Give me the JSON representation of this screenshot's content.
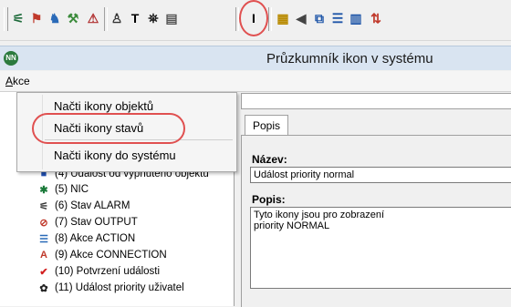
{
  "toolbar": {
    "buttons": [
      {
        "name": "connect-icon",
        "glyph": "⚟",
        "color": "#1d6a3a"
      },
      {
        "name": "flag-icon",
        "glyph": "⚑",
        "color": "#c0392b"
      },
      {
        "name": "users-icon",
        "glyph": "♞",
        "color": "#2a6ab8"
      },
      {
        "name": "tools-icon",
        "glyph": "⚒",
        "color": "#3a8a3a"
      },
      {
        "name": "alarm-icon",
        "glyph": "⚠",
        "color": "#b03030"
      },
      {
        "name": "user-text-icon",
        "glyph": "♙",
        "color": "#333"
      },
      {
        "name": "text-icon",
        "glyph": "T",
        "color": "#000"
      },
      {
        "name": "binoculars-icon",
        "glyph": "⛯",
        "color": "#222"
      },
      {
        "name": "document-icon",
        "glyph": "▤",
        "color": "#555"
      },
      {
        "name": "icon-explorer-icon",
        "glyph": "I",
        "color": "#000"
      },
      {
        "name": "graph-icon",
        "glyph": "▦",
        "color": "#b88a00"
      },
      {
        "name": "sound-icon",
        "glyph": "◀",
        "color": "#444"
      },
      {
        "name": "windows-icon",
        "glyph": "⧉",
        "color": "#1f56a8"
      },
      {
        "name": "horizontal-split-icon",
        "glyph": "☰",
        "color": "#1f56a8"
      },
      {
        "name": "vertical-split-icon",
        "glyph": "▥",
        "color": "#1f56a8"
      },
      {
        "name": "sort-icon",
        "glyph": "⇅",
        "color": "#c0392b"
      }
    ]
  },
  "window": {
    "title": "Průzkumník ikon v systému",
    "app_icon_text": "NN"
  },
  "menu": {
    "akce_label_first": "A",
    "akce_label_rest": "kce",
    "dropdown": [
      "Načti ikony objektů",
      "Načti ikony stavů",
      "Načti ikony do systému"
    ]
  },
  "tree": {
    "items": [
      {
        "label": "(4) Událost od vypnutého objektu",
        "icon": "■",
        "color": "#1f4fb0"
      },
      {
        "label": "(5) NIC",
        "icon": "✱",
        "color": "#1b7a3a"
      },
      {
        "label": "(6) Stav ALARM",
        "icon": "⚟",
        "color": "#333"
      },
      {
        "label": "(7) Stav OUTPUT",
        "icon": "⊘",
        "color": "#c0392b"
      },
      {
        "label": "(8) Akce ACTION",
        "icon": "☰",
        "color": "#2a6ab8"
      },
      {
        "label": "(9) Akce CONNECTION",
        "icon": "A",
        "color": "#c0392b"
      },
      {
        "label": "(10) Potvrzení události",
        "icon": "✔",
        "color": "#d22020"
      },
      {
        "label": "(11) Událost priority uživatel",
        "icon": "✿",
        "color": "#222"
      }
    ]
  },
  "detail": {
    "tab_label": "Popis",
    "name_label": "Název:",
    "name_value": "Událost priority normal",
    "desc_label": "Popis:",
    "desc_line1": "Tyto ikony jsou pro zobrazení",
    "desc_line2": "priority NORMAL"
  }
}
